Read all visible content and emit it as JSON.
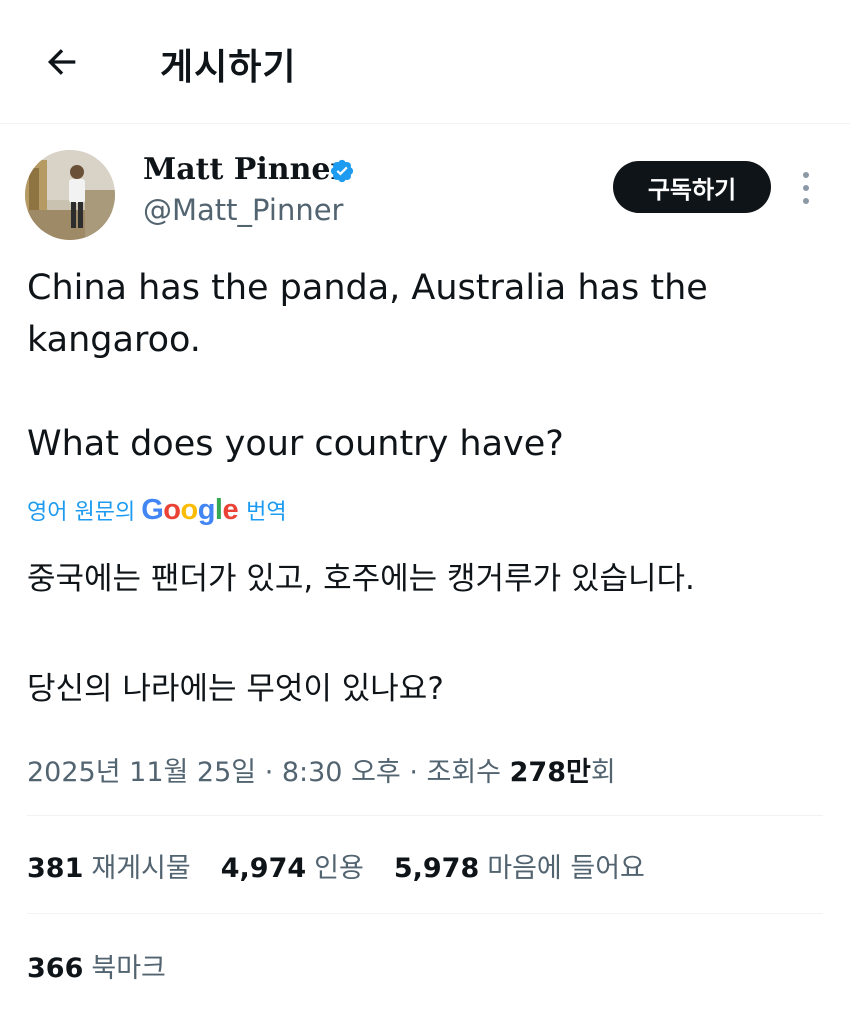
{
  "header": {
    "title": "게시하기",
    "back_icon": "arrow-left-icon"
  },
  "author": {
    "display_name": "Matt Pinner",
    "handle": "@Matt_Pinner",
    "verified": true,
    "verified_color": "#1d9bf0"
  },
  "actions": {
    "subscribe_label": "구독하기",
    "more_icon": "more-vertical-icon"
  },
  "tweet": {
    "line1": "China has the panda, Australia has the kangaroo.",
    "line2": "What does your country have?"
  },
  "translation": {
    "label": "영어 원문의",
    "provider": "Google",
    "action": "번역",
    "line1": "중국에는 팬더가 있고, 호주에는 캥거루가 있습니다.",
    "line2": "당신의 나라에는 무엇이 있나요?"
  },
  "meta": {
    "timestamp": "2025년 11월 25일 · 8:30 오후 · 조회수",
    "views_number": "278만",
    "views_suffix": "회"
  },
  "stats": {
    "reposts_count": "381",
    "reposts_label": "재게시물",
    "quotes_count": "4,974",
    "quotes_label": "인용",
    "likes_count": "5,978",
    "likes_label": "마음에 들어요",
    "bookmarks_count": "366",
    "bookmarks_label": "북마크"
  },
  "colors": {
    "text": "#0f1419",
    "secondary": "#536471",
    "accent": "#1d9bf0",
    "button_bg": "#0f1419"
  }
}
